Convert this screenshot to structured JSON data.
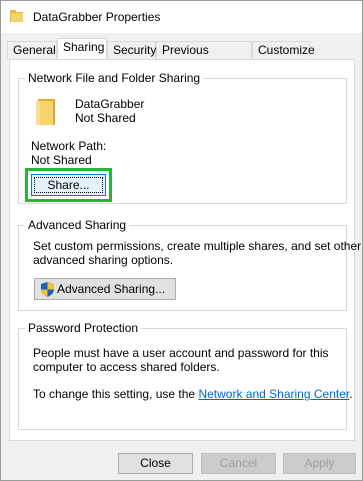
{
  "window": {
    "title": "DataGrabber Properties"
  },
  "tabs": [
    {
      "label": "General"
    },
    {
      "label": "Sharing"
    },
    {
      "label": "Security"
    },
    {
      "label": "Previous Versions"
    },
    {
      "label": "Customize"
    }
  ],
  "active_tab": "Sharing",
  "network_sharing": {
    "group_title": "Network File and Folder Sharing",
    "folder_name": "DataGrabber",
    "folder_status": "Not Shared",
    "network_path_label": "Network Path:",
    "network_path_value": "Not Shared",
    "share_button": "Share..."
  },
  "advanced_sharing": {
    "group_title": "Advanced Sharing",
    "description_line1": "Set custom permissions, create multiple shares, and set other",
    "description_line2": "advanced sharing options.",
    "button": "Advanced Sharing..."
  },
  "password_protection": {
    "group_title": "Password Protection",
    "line1": "People must have a user account and password for this",
    "line2": "computer to access shared folders.",
    "line3_prefix": "To change this setting, use the ",
    "link": "Network and Sharing Center",
    "line3_suffix": "."
  },
  "footer": {
    "close": "Close",
    "cancel": "Cancel",
    "apply": "Apply"
  },
  "colors": {
    "highlight": "#2bb13c",
    "link": "#0066cc",
    "folder": "#f4c542"
  }
}
